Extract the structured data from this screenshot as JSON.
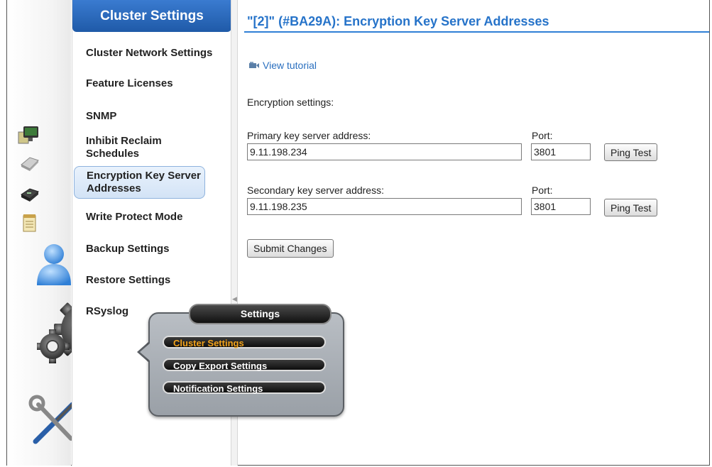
{
  "nav": {
    "header": "Cluster Settings",
    "items": [
      {
        "label": "Cluster Network Settings"
      },
      {
        "label": "Feature Licenses"
      },
      {
        "label": "SNMP"
      },
      {
        "label": "Inhibit Reclaim Schedules"
      },
      {
        "label": "Encryption Key Server Addresses",
        "active": true
      },
      {
        "label": "Write Protect Mode"
      },
      {
        "label": "Backup Settings"
      },
      {
        "label": "Restore Settings"
      },
      {
        "label": "RSyslog"
      }
    ]
  },
  "main": {
    "title": "\"[2]\" (#BA29A): Encryption Key Server Addresses",
    "tutorial_link": "View tutorial",
    "section_label": "Encryption settings:",
    "primary": {
      "label": "Primary key server address:",
      "value": "9.11.198.234",
      "port_label": "Port:",
      "port_value": "3801",
      "ping_label": "Ping Test"
    },
    "secondary": {
      "label": "Secondary key server address:",
      "value": "9.11.198.235",
      "port_label": "Port:",
      "port_value": "3801",
      "ping_label": "Ping Test"
    },
    "submit_label": "Submit Changes"
  },
  "popup": {
    "title": "Settings",
    "items": [
      {
        "label": "Cluster Settings",
        "active": true
      },
      {
        "label": "Copy Export Settings"
      },
      {
        "label": "Notification Settings"
      }
    ]
  },
  "sidebar_icons": [
    "monitor-icon",
    "drive-icon",
    "tape-drive-icon",
    "notepad-icon",
    "user-icon",
    "gears-icon",
    "tools-icon"
  ],
  "colors": {
    "accent": "#2673c9",
    "nav_header": "#1f5aa8",
    "active_pill_text": "#f2a21a"
  }
}
